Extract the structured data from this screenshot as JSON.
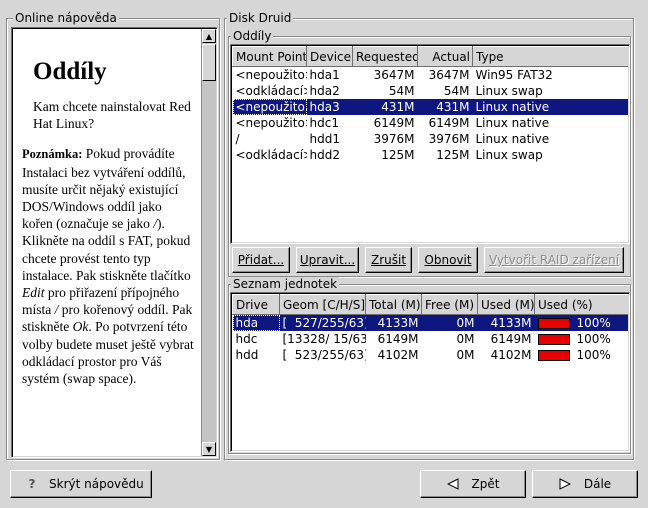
{
  "help": {
    "frame_title": "Online nápověda",
    "heading": "Oddíly",
    "intro": "Kam chcete nainstalovat Red Hat Linux?",
    "note_label": "Poznámka:",
    "note_p1": " Pokud provádíte Instalaci bez vytváření oddílů, musíte určit nějaký existující DOS/Windows oddíl jako kořen (označuje se jako ",
    "note_slash1": "/",
    "note_p2": "). Klikněte na oddíl s FAT, pokud chcete provést tento typ instalace. Pak stiskněte tlačítko ",
    "note_edit": "Edit",
    "note_p3": " pro přiřazení přípojného místa ",
    "note_slash2": "/",
    "note_p4": " pro kořenový oddíl. Pak stiskněte ",
    "note_ok": "Ok",
    "note_p5": ". Po potvrzení této volby budete muset ještě vybrat odkládací prostor pro Váš systém (swap space).",
    "up_arrow": "▲",
    "down_arrow": "▼"
  },
  "druid": {
    "frame_title": "Disk Druid",
    "partitions_title": "Oddíly",
    "partition_columns": [
      "Mount Point",
      "Device",
      "Requested",
      "Actual",
      "Type"
    ],
    "partitions": [
      {
        "mount": "<nepoužito>",
        "device": "hda1",
        "requested": "3647M",
        "actual": "3647M",
        "type": "Win95 FAT32"
      },
      {
        "mount": "<odkládací>",
        "device": "hda2",
        "requested": "54M",
        "actual": "54M",
        "type": "Linux swap"
      },
      {
        "mount": "<nepoužito>",
        "device": "hda3",
        "requested": "431M",
        "actual": "431M",
        "type": "Linux native"
      },
      {
        "mount": "<nepoužito>",
        "device": "hdc1",
        "requested": "6149M",
        "actual": "6149M",
        "type": "Linux native"
      },
      {
        "mount": "/",
        "device": "hdd1",
        "requested": "3976M",
        "actual": "3976M",
        "type": "Linux native"
      },
      {
        "mount": "<odkládací>",
        "device": "hdd2",
        "requested": "125M",
        "actual": "125M",
        "type": "Linux swap"
      }
    ],
    "buttons": {
      "add": "Přidat...",
      "edit": "Upravit...",
      "delete": "Zrušit",
      "reset": "Obnovit",
      "raid": "Vytvořit RAID zařízení"
    },
    "drives_title": "Seznam jednotek",
    "drive_columns": [
      "Drive",
      "Geom [C/H/S]",
      "Total (M)",
      "Free (M)",
      "Used (M)",
      "Used (%)"
    ],
    "drives": [
      {
        "drive": "hda",
        "geom": "[  527/255/63]",
        "total": "4133M",
        "free": "0M",
        "used": "4133M",
        "used_pct_label": "100%",
        "used_fraction": 1.0
      },
      {
        "drive": "hdc",
        "geom": "[13328/ 15/63]",
        "total": "6149M",
        "free": "0M",
        "used": "6149M",
        "used_pct_label": "100%",
        "used_fraction": 1.0
      },
      {
        "drive": "hdd",
        "geom": "[  523/255/63]",
        "total": "4102M",
        "free": "0M",
        "used": "4102M",
        "used_pct_label": "100%",
        "used_fraction": 1.0
      }
    ]
  },
  "footer": {
    "hide_help": "Skrýt nápovědu",
    "back": "Zpět",
    "next": "Dále"
  },
  "colors": {
    "selection": "#0e1680",
    "usage_bar": "#e80000",
    "background": "#d6d6d6"
  }
}
